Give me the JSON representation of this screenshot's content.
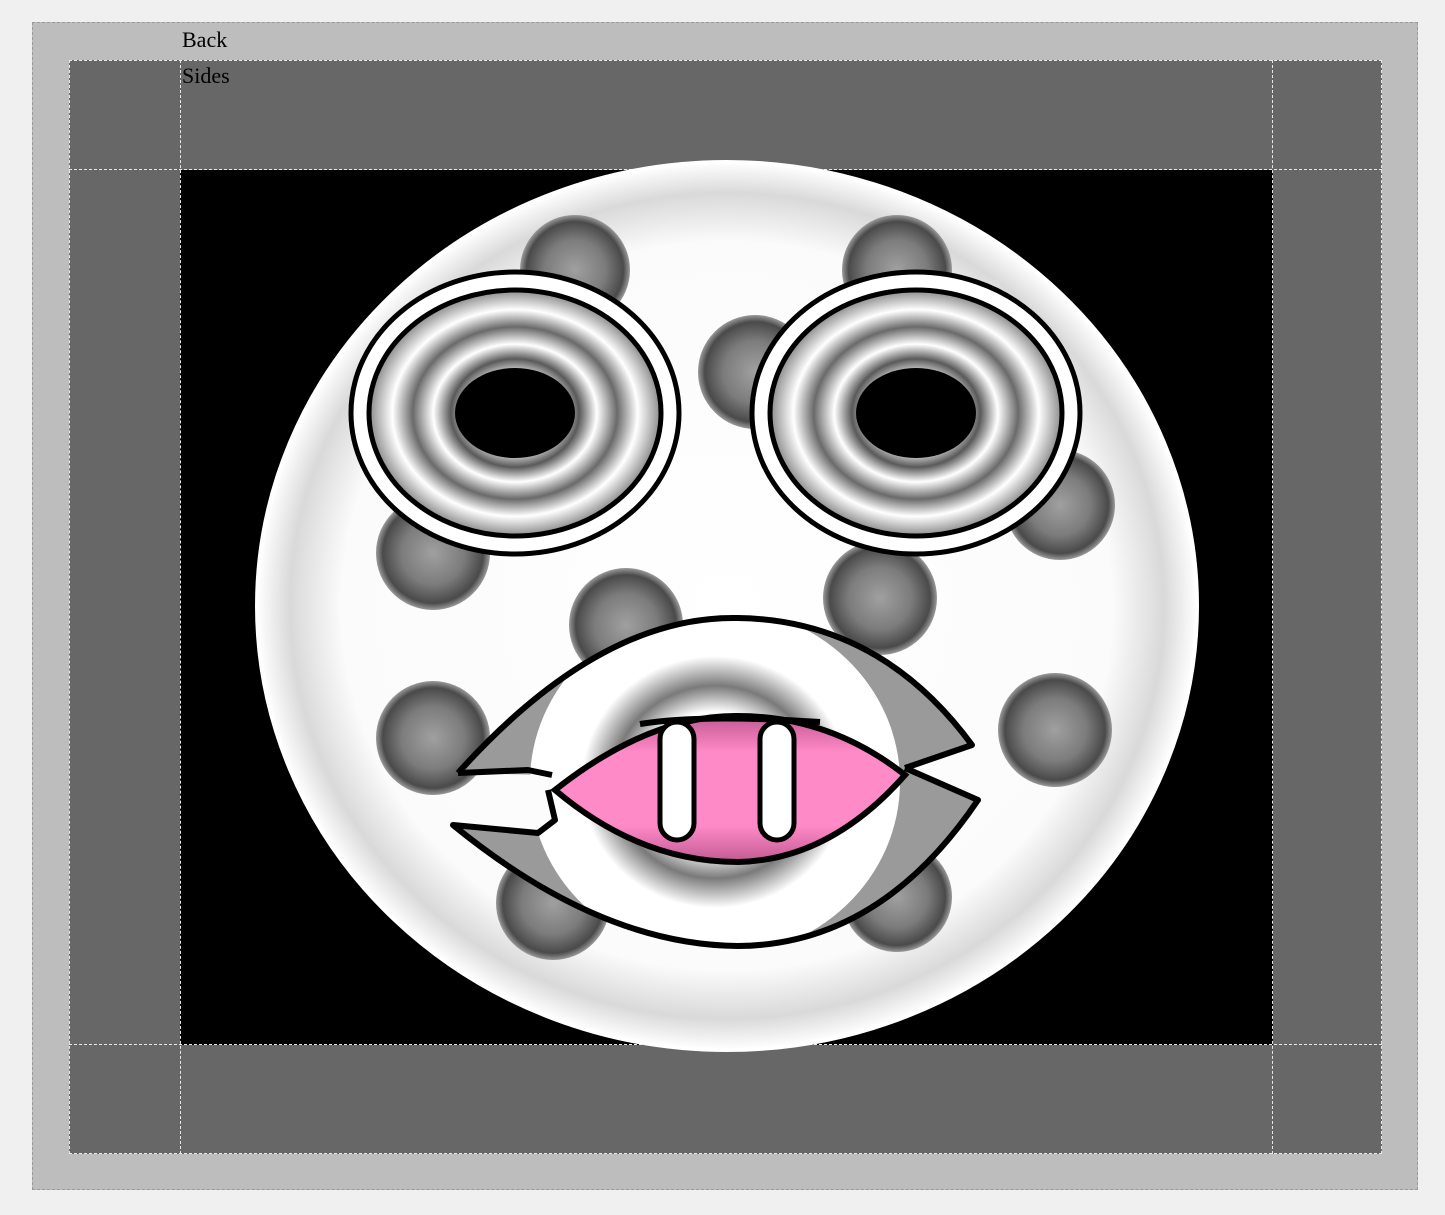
{
  "labels": {
    "back": "Back",
    "sides": "Sides"
  },
  "colors": {
    "page_background": "#f0f0f0",
    "outer_frame": "#bdbdbd",
    "inner_frame": "#676767",
    "content_background": "#000000",
    "face_fill": "#ffffff",
    "tongue": "#ff8ac8",
    "outline": "#000000"
  },
  "face": {
    "eyes": [
      "left-eye",
      "right-eye"
    ],
    "mouth": [
      "upper-lip",
      "lower-lip",
      "tongue",
      "teeth"
    ],
    "spot_count": 12
  }
}
